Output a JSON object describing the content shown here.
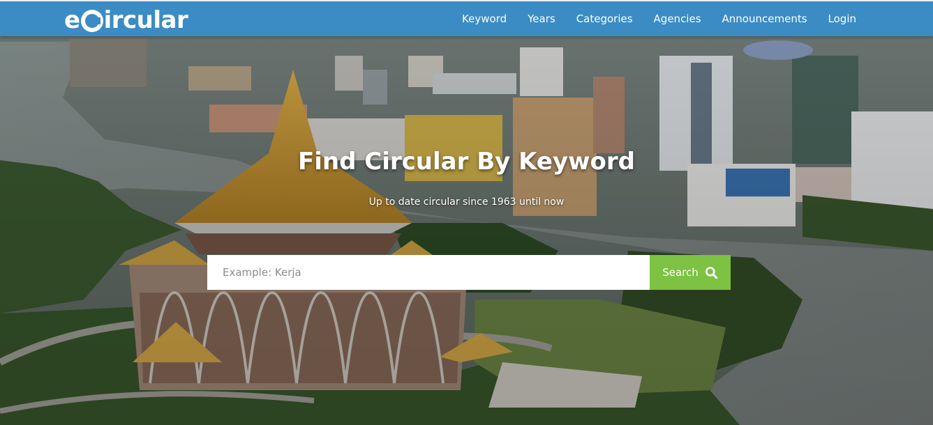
{
  "brand": {
    "logo_prefix": "e",
    "logo_suffix": "ircular"
  },
  "nav": {
    "items": [
      {
        "label": "Keyword"
      },
      {
        "label": "Years"
      },
      {
        "label": "Categories"
      },
      {
        "label": "Agencies"
      },
      {
        "label": "Announcements"
      },
      {
        "label": "Login"
      }
    ]
  },
  "hero": {
    "title": "Find Circular By Keyword",
    "subtitle": "Up to date circular since 1963 until now"
  },
  "search": {
    "placeholder": "Example: Kerja",
    "value": "",
    "button_label": "Search",
    "button_icon": "search-icon"
  },
  "colors": {
    "navbar": "#3b8cc4",
    "search_button": "#7dc242",
    "text": "#ffffff"
  }
}
